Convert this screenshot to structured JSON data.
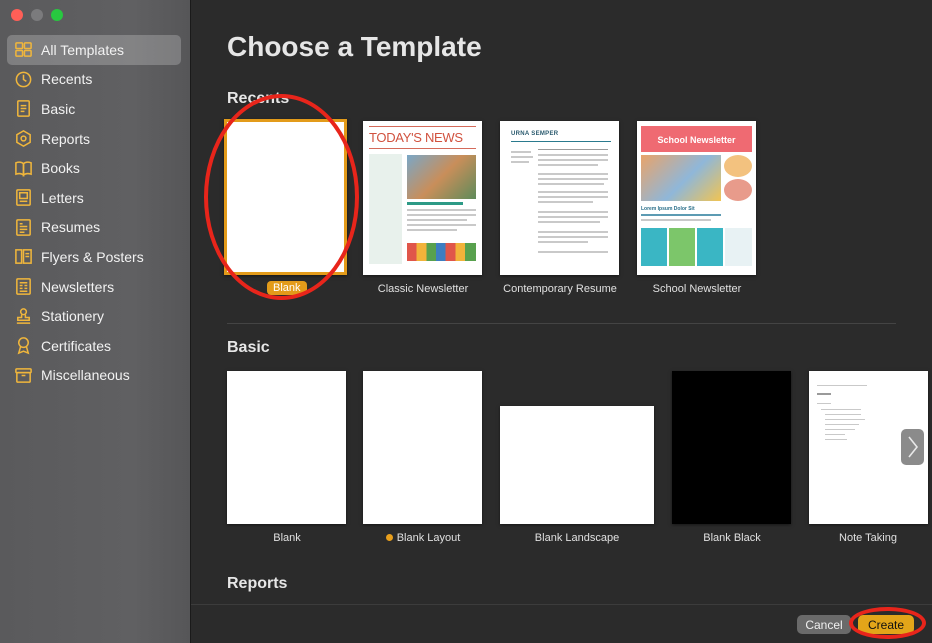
{
  "window": {
    "traffic_lights": [
      "close",
      "minimize",
      "maximize"
    ]
  },
  "sidebar": {
    "items": [
      {
        "label": "All Templates",
        "icon": "all-templates-icon",
        "active": true
      },
      {
        "label": "Recents",
        "icon": "clock-icon"
      },
      {
        "label": "Basic",
        "icon": "document-icon"
      },
      {
        "label": "Reports",
        "icon": "reports-icon"
      },
      {
        "label": "Books",
        "icon": "book-icon"
      },
      {
        "label": "Letters",
        "icon": "letter-icon"
      },
      {
        "label": "Resumes",
        "icon": "resume-icon"
      },
      {
        "label": "Flyers & Posters",
        "icon": "flyer-icon"
      },
      {
        "label": "Newsletters",
        "icon": "newsletter-icon"
      },
      {
        "label": "Stationery",
        "icon": "stamp-icon"
      },
      {
        "label": "Certificates",
        "icon": "certificate-icon"
      },
      {
        "label": "Miscellaneous",
        "icon": "misc-icon"
      }
    ]
  },
  "main": {
    "title": "Choose a Template",
    "sections": {
      "recents": {
        "label": "Recents"
      },
      "basic": {
        "label": "Basic"
      },
      "reports": {
        "label": "Reports"
      }
    },
    "recents": [
      {
        "label": "Blank",
        "selected": true
      },
      {
        "label": "Classic Newsletter"
      },
      {
        "label": "Contemporary Resume"
      },
      {
        "label": "School Newsletter"
      }
    ],
    "basic": [
      {
        "label": "Blank"
      },
      {
        "label": "Blank Layout",
        "dot": true
      },
      {
        "label": "Blank Landscape"
      },
      {
        "label": "Blank Black"
      },
      {
        "label": "Note Taking"
      }
    ],
    "thumb_text": {
      "classic_headline": "TODAY'S NEWS",
      "resume_name": "URNA SEMPER",
      "school_headline": "School Newsletter",
      "school_sub": "Lorem Ipsum Dolor Sit"
    }
  },
  "footer": {
    "cancel_label": "Cancel",
    "create_label": "Create"
  },
  "colors": {
    "accent": "#e3a519",
    "annotation": "#e8251b",
    "selection": "#e39b1a"
  }
}
